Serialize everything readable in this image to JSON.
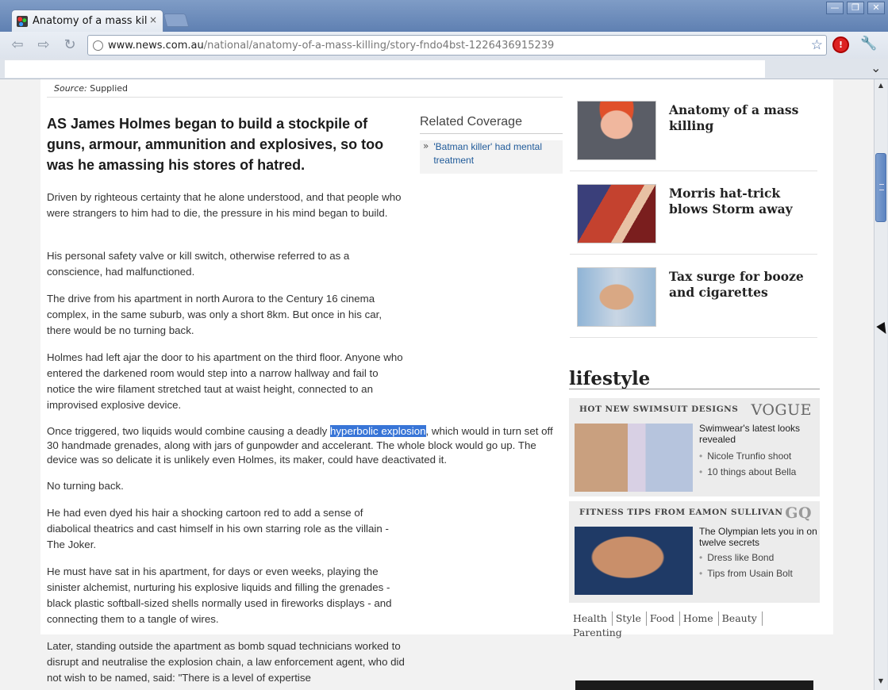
{
  "browser": {
    "tab_title": "Anatomy of a mass killi",
    "tab_close": "×",
    "url_host": "www.news.com.au",
    "url_path": "/national/anatomy-of-a-mass-killing/story-fndo4bst-1226436915239",
    "window_buttons": [
      "—",
      "❐",
      "✕"
    ],
    "nav": {
      "back": "⇦",
      "forward": "⇨",
      "reload": "↻"
    },
    "star": "☆",
    "extension": "!",
    "wrench": "🔧",
    "bookmark_chevron": "⌄"
  },
  "article": {
    "source_label": "Source:",
    "source_value": "Supplied",
    "lead": "AS James Holmes began to build a stockpile of guns, armour, ammunition and explosives, so too was he amassing his stores of hatred.",
    "related_title": "Related Coverage",
    "related_arrow": "»",
    "related_link": "'Batman killer' had mental treatment",
    "paragraphs": [
      "Driven by righteous certainty that he alone understood, and that people who were strangers to him had to die, the pressure in his mind began to build.",
      "His personal safety valve or kill switch, otherwise referred to as a conscience, had malfunctioned.",
      "The drive from his apartment in north Aurora to the Century 16 cinema complex, in the same suburb, was only a short 8km. But once in his car, there would be no turning back.",
      "Holmes had left ajar the door to his apartment on the third floor. Anyone who entered the darkened room would step into a narrow hallway and fail to notice the wire filament stretched taut at waist height, connected to an improvised explosive device.",
      "No turning back.",
      "He had even dyed his hair a shocking cartoon red to add a sense of diabolical theatrics and cast himself in his own starring role as the villain - The Joker.",
      "He must have sat in his apartment, for days or even weeks, playing the sinister alchemist, nurturing his explosive liquids and filling the grenades - black plastic softball-sized shells normally used in fireworks displays - and connecting them to a tangle of wires.",
      "Later, standing outside the apartment as bomb squad technicians worked to disrupt and neutralise the explosion chain, a law enforcement agent, who did not wish to be named, said: \"There is a level of expertise"
    ],
    "trigger_before": "Once triggered, two liquids would combine causing a deadly ",
    "trigger_highlight": "hyperbolic explosion",
    "trigger_after": ", which would in turn set off 30 handmade grenades, along with jars of gunpowder and accelerant. The whole block would go up. The device was so delicate it is unlikely even Holmes, its maker, could have deactivated it."
  },
  "sidebar": {
    "stories": [
      {
        "title": "Anatomy of a mass killing"
      },
      {
        "title": "Morris hat-trick blows Storm away"
      },
      {
        "title": "Tax surge for booze and cigarettes"
      }
    ],
    "lifestyle_heading": "lifestyle",
    "boxes": [
      {
        "heading": "HOT NEW SWIMSUIT DESIGNS",
        "brand": "VOGUE",
        "main": "Swimwear's latest looks revealed",
        "subs": [
          "Nicole Trunfio shoot",
          "10 things about Bella"
        ]
      },
      {
        "heading": "FITNESS TIPS FROM EAMON SULLIVAN",
        "brand": "GQ",
        "main": "The Olympian lets you in on twelve secrets",
        "subs": [
          "Dress like Bond",
          "Tips from Usain Bolt"
        ]
      }
    ],
    "categories": [
      "Health",
      "Style",
      "Food",
      "Home",
      "Beauty",
      "Parenting"
    ]
  },
  "scrollbar": {
    "up": "▲",
    "down": "▼",
    "position": 0.12
  }
}
